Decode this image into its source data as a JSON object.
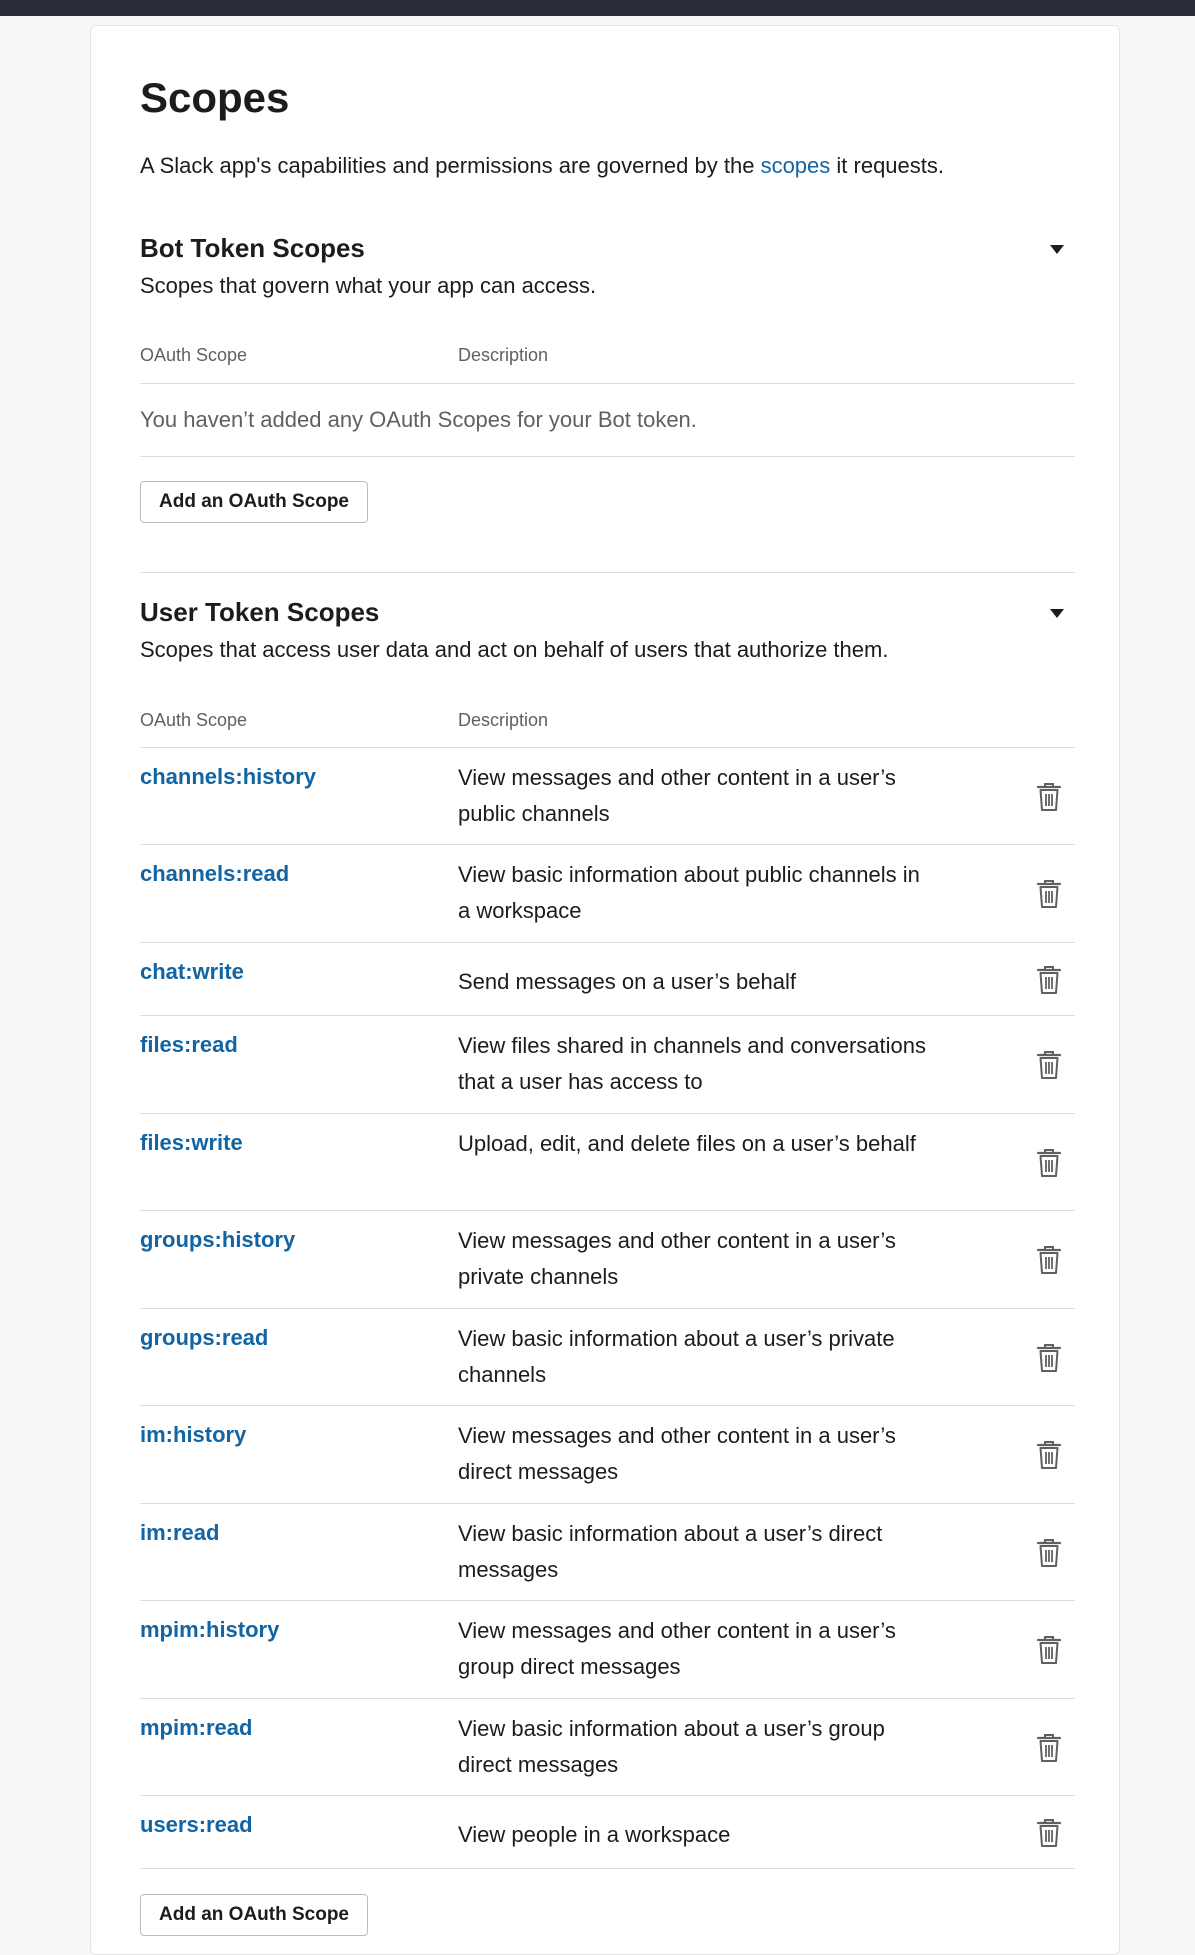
{
  "page": {
    "title": "Scopes",
    "intro_before": "A Slack app's capabilities and permissions are governed by the ",
    "intro_link": "scopes",
    "intro_after": " it requests."
  },
  "bot": {
    "title": "Bot Token Scopes",
    "subtitle": "Scopes that govern what your app can access.",
    "col_scope": "OAuth Scope",
    "col_desc": "Description",
    "empty": "You haven’t added any OAuth Scopes for your Bot token.",
    "add_label": "Add an OAuth Scope"
  },
  "user": {
    "title": "User Token Scopes",
    "subtitle": "Scopes that access user data and act on behalf of users that authorize them.",
    "col_scope": "OAuth Scope",
    "col_desc": "Description",
    "add_label": "Add an OAuth Scope",
    "scopes": [
      {
        "name": "channels:history",
        "desc": "View messages and other content in a user’s public channels"
      },
      {
        "name": "channels:read",
        "desc": "View basic information about public channels in a workspace"
      },
      {
        "name": "chat:write",
        "desc": "Send messages on a user’s behalf"
      },
      {
        "name": "files:read",
        "desc": "View files shared in channels and conversations that a user has access to"
      },
      {
        "name": "files:write",
        "desc": "Upload, edit, and delete files on a user’s behalf"
      },
      {
        "name": "groups:history",
        "desc": "View messages and other content in a user’s private channels"
      },
      {
        "name": "groups:read",
        "desc": "View basic information about a user’s private channels"
      },
      {
        "name": "im:history",
        "desc": "View messages and other content in a user’s direct messages"
      },
      {
        "name": "im:read",
        "desc": "View basic information about a user’s direct messages"
      },
      {
        "name": "mpim:history",
        "desc": "View messages and other content in a user’s group direct messages"
      },
      {
        "name": "mpim:read",
        "desc": "View basic information about a user’s group direct messages"
      },
      {
        "name": "users:read",
        "desc": "View people in a workspace"
      }
    ]
  },
  "icons": {
    "collapse": "caret-down-icon",
    "remove": "trash-icon"
  },
  "colors": {
    "link": "#1264a3",
    "topbar": "#2c2d3a"
  }
}
